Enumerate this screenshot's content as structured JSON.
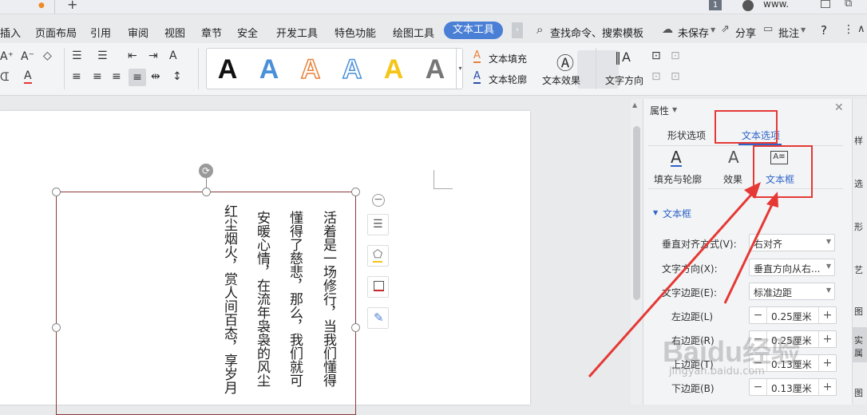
{
  "titlebar": {
    "page_badge": "1",
    "username": "www."
  },
  "menu": {
    "items": [
      "插入",
      "页面布局",
      "引用",
      "审阅",
      "视图",
      "章节",
      "安全",
      "开发工具",
      "特色功能",
      "绘图工具"
    ],
    "active": "文本工具",
    "search": "查找命令、搜索模板",
    "unsaved": "未保存",
    "share": "分享",
    "comment": "批注",
    "help": "?"
  },
  "ribbon": {
    "text_fill": "文本填充",
    "text_outline": "文本轮廓",
    "text_effect": "文本效果",
    "text_direction": "文字方向",
    "style_letters": [
      "A",
      "A",
      "A",
      "A",
      "A",
      "A"
    ],
    "style_colors": [
      "#111111",
      "#4a90d9",
      "#e8823a",
      "#4a90d9",
      "#f5c518",
      "#777777"
    ]
  },
  "document": {
    "columns": [
      "活着是一场修行，当我们懂得",
      "懂得了慈悲，那么，我们就可",
      "安暖心情，在流年袅袅的风尘",
      "红尘烟火，赏人间百态，享岁月"
    ]
  },
  "panel": {
    "title": "属性",
    "tabs": [
      "形状选项",
      "文本选项"
    ],
    "subtabs": [
      "填充与轮廓",
      "效果",
      "文本框"
    ],
    "section": "文本框",
    "rows": [
      {
        "label": "垂直对齐方式(V):",
        "value": "右对齐"
      },
      {
        "label": "文字方向(X):",
        "value": "垂直方向从右..."
      },
      {
        "label": "文字边距(E):",
        "value": "标准边距"
      }
    ],
    "margins": [
      {
        "label": "左边距(L)",
        "value": "0.25厘米"
      },
      {
        "label": "右边距(R)",
        "value": "0.25厘米"
      },
      {
        "label": "上边距(T)",
        "value": "0.13厘米"
      },
      {
        "label": "下边距(B)",
        "value": "0.13厘米"
      }
    ]
  },
  "rightbar": {
    "items": [
      "样",
      "选",
      "形",
      "艺",
      "图",
      "实",
      "属",
      "图"
    ]
  },
  "watermark": {
    "brand": "Baidu经验",
    "url": "jingyan.baidu.com"
  }
}
